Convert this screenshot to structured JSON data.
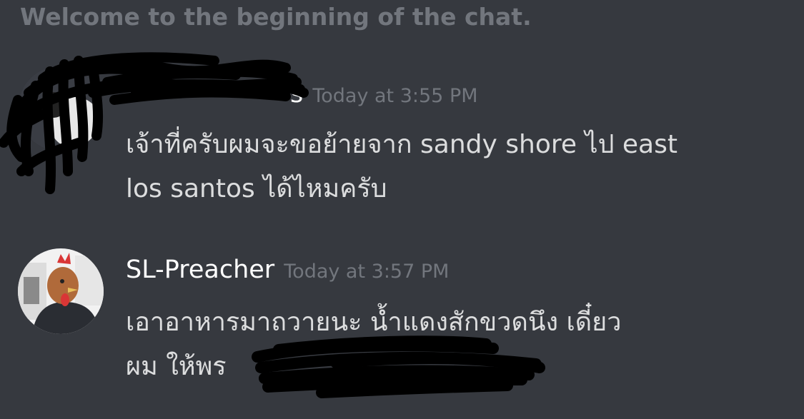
{
  "chat": {
    "welcome_text": "Welcome to the beginning of the chat."
  },
  "messages": [
    {
      "username": "",
      "username_visible_fragment": "s",
      "timestamp": "Today at 3:55 PM",
      "lines": [
        "เจ้าที่ครับผมจะขอย้ายจาก sandy shore ไป east",
        "los santos ได้ไหมครับ"
      ]
    },
    {
      "username": "SL-Preacher",
      "timestamp": "Today at 3:57 PM",
      "lines": [
        "เอาอาหารมาถวายนะ น้ำแดงสักขวดนึง เดี๋ยว",
        "ผม ให้พร"
      ]
    }
  ],
  "colors": {
    "background": "#36393f",
    "welcome": "#72767d",
    "username": "#ffffff",
    "timestamp": "#72767d",
    "text": "#dcddde",
    "redaction": "#000000"
  },
  "icons": {
    "avatar_1": "user-avatar-icon",
    "avatar_2": "rooster-mask-avatar-icon"
  }
}
